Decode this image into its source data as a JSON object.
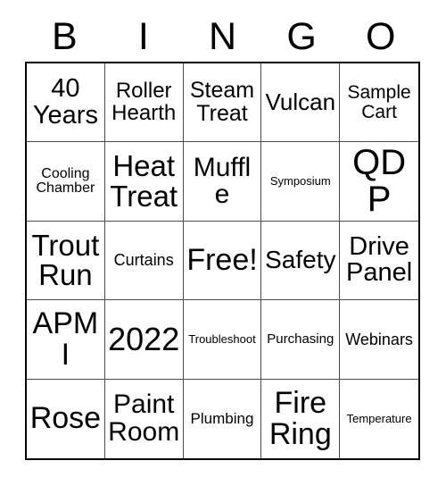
{
  "card": {
    "header_letters": [
      "B",
      "I",
      "N",
      "G",
      "O"
    ],
    "free_space_label": "Free!",
    "rows": [
      [
        {
          "label": "40 Years",
          "font_size": "29px"
        },
        {
          "label": "Roller Hearth",
          "font_size": "24px"
        },
        {
          "label": "Steam Treat",
          "font_size": "25px"
        },
        {
          "label": "Vulcan",
          "font_size": "26px"
        },
        {
          "label": "Sample Cart",
          "font_size": "21px"
        }
      ],
      [
        {
          "label": "Cooling Chamber",
          "font_size": "16px"
        },
        {
          "label": "Heat Treat",
          "font_size": "33px"
        },
        {
          "label": "Muffle",
          "font_size": "30px"
        },
        {
          "label": "Symposium",
          "font_size": "13px"
        },
        {
          "label": "QDP",
          "font_size": "40px"
        }
      ],
      [
        {
          "label": "Trout Run",
          "font_size": "33px"
        },
        {
          "label": "Curtains",
          "font_size": "18px"
        },
        {
          "label": "Free!",
          "font_size": "34px"
        },
        {
          "label": "Safety",
          "font_size": "28px"
        },
        {
          "label": "Drive Panel",
          "font_size": "29px"
        }
      ],
      [
        {
          "label": "APMI",
          "font_size": "34px"
        },
        {
          "label": "2022",
          "font_size": "36px"
        },
        {
          "label": "Troubleshoot",
          "font_size": "13px"
        },
        {
          "label": "Purchasing",
          "font_size": "15px"
        },
        {
          "label": "Webinars",
          "font_size": "18px"
        }
      ],
      [
        {
          "label": "Rose",
          "font_size": "34px"
        },
        {
          "label": "Paint Room",
          "font_size": "30px"
        },
        {
          "label": "Plumbing",
          "font_size": "17px"
        },
        {
          "label": "Fire Ring",
          "font_size": "34px"
        },
        {
          "label": "Temperature",
          "font_size": "13px"
        }
      ]
    ]
  }
}
